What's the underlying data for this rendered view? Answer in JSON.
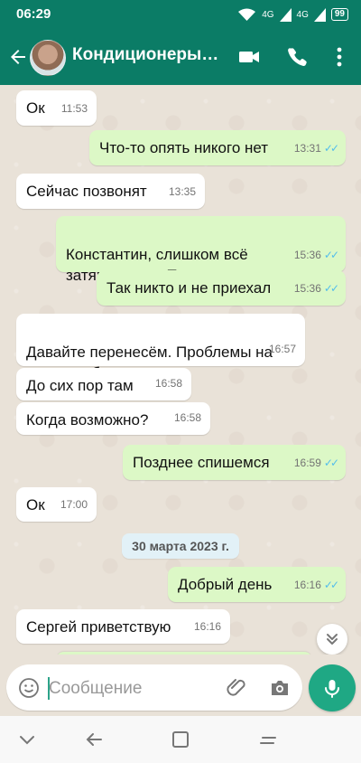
{
  "status": {
    "time": "06:29",
    "network_1": "4G",
    "network_2": "4G",
    "battery": "99"
  },
  "header": {
    "contact_name": "Кондиционеры…"
  },
  "chat": {
    "messages": [
      {
        "text": "Ок",
        "time": "11:53"
      },
      {
        "text": "Что-то опять никого нет",
        "time": "13:31"
      },
      {
        "text": "Сейчас позвонят",
        "time": "13:35"
      },
      {
        "text": "Константин, слишком всё\nзатягивается. Перенесем",
        "time": "15:36"
      },
      {
        "text": "Так никто и не приехал",
        "time": "15:36"
      },
      {
        "text": "Давайте перенесём. Проблемы на\nпервом объекте.",
        "time": "16:57"
      },
      {
        "text": "До сих пор там",
        "time": "16:58"
      },
      {
        "text": "Когда возможно?",
        "time": "16:58"
      },
      {
        "text": "Позднее спишемся",
        "time": "16:59"
      },
      {
        "text": "Ок",
        "time": "17:00"
      },
      {
        "text": "Добрый день",
        "time": "16:16"
      },
      {
        "text": "Сергей приветствую",
        "time": "16:16"
      }
    ],
    "date_separator": "30 марта 2023 г."
  },
  "composer": {
    "placeholder": "Сообщение"
  },
  "colors": {
    "primary": "#0b7c66",
    "outgoing_bubble": "#dcf8c6",
    "incoming_bubble": "#ffffff",
    "mic_button": "#1fa884",
    "read_ticks": "#53bdeb"
  },
  "icons": {
    "video_call": "video-camera-icon",
    "voice_call": "phone-icon",
    "menu": "more-vertical-icon",
    "attach": "paperclip-icon",
    "camera": "camera-icon",
    "voice_message": "microphone-icon"
  }
}
